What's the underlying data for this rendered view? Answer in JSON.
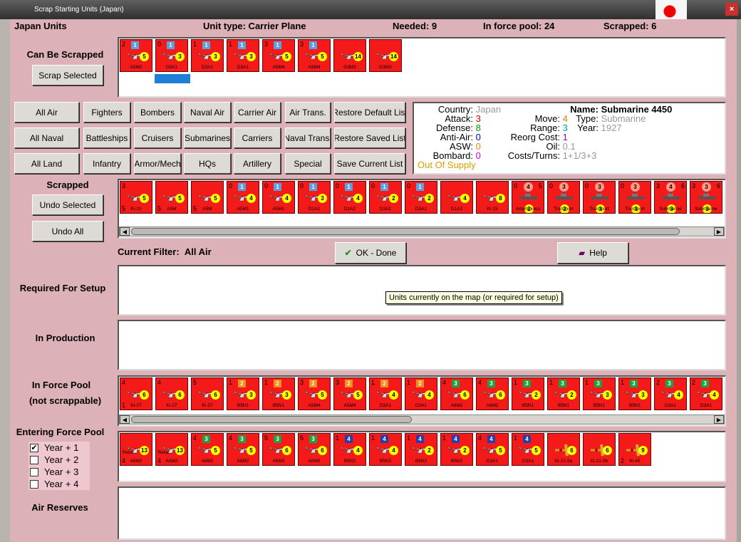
{
  "window": {
    "title": "Scrap Starting Units (Japan)"
  },
  "header": {
    "nation": "Japan Units",
    "unit_type": "Unit type: Carrier Plane",
    "needed": "Needed:  9",
    "force_pool": "In force pool:  24",
    "scrapped": "Scrapped:  6"
  },
  "sections": {
    "can_be_scrapped": "Can Be Scrapped",
    "scrapped": "Scrapped",
    "required": "Required For Setup",
    "in_production": "In Production",
    "in_force_pool": "In Force Pool",
    "not_scrappable": "(not scrappable)",
    "entering": "Entering Force Pool",
    "air_reserves": "Air Reserves"
  },
  "buttons": {
    "scrap_selected": "Scrap Selected",
    "undo_selected": "Undo Selected",
    "undo_all": "Undo All",
    "ok": "OK - Done",
    "help": "Help"
  },
  "filters": [
    [
      "All Air",
      "Fighters",
      "Bombers",
      "Naval Air",
      "Carrier Air",
      "Air Trans.",
      "Restore Default List"
    ],
    [
      "All Naval",
      "Battleships",
      "Cruisers",
      "Submarines",
      "Carriers",
      "Naval Trans.",
      "Restore Saved List"
    ],
    [
      "All Land",
      "Infantry",
      "Armor/Mech",
      "HQs",
      "Artillery",
      "Special",
      "Save Current List"
    ]
  ],
  "current_filter": {
    "label": "Current Filter:",
    "value": "All Air"
  },
  "tooltip": "Units currently on the map (or required for setup)",
  "info": {
    "country_k": "Country:",
    "country_v": "Japan",
    "attack_k": "Attack:",
    "attack_v": "3",
    "defense_k": "Defense:",
    "defense_v": "8",
    "antiair_k": "Anti-Air:",
    "antiair_v": "0",
    "asw_k": "ASW:",
    "asw_v": "0",
    "bombard_k": "Bombard:",
    "bombard_v": "0",
    "supply": "Out Of Supply",
    "move_k": "Move:",
    "move_v": "4",
    "range_k": "Range:",
    "range_v": "3",
    "reorg_k": "Reorg Cost:",
    "reorg_v": "1",
    "oil_k": "Oil:",
    "oil_v": "0.1",
    "costs_k": "Costs/Turns:",
    "costs_v": "1+1/3+3",
    "name_k": "Name:",
    "name_v": "Submarine 4450",
    "type_k": "Type:",
    "type_v": "Submarine",
    "year_k": "Year:",
    "year_v": "1927"
  },
  "years": [
    "Year + 1",
    "Year + 2",
    "Year + 3",
    "Year + 4"
  ],
  "counters": {
    "can_scrap": [
      {
        "tl": "2",
        "tr": "",
        "badge": "1",
        "bc": "#5aa0e0",
        "nm": "A5M2",
        "circ": "5",
        "bl": "",
        "br": "",
        "art": "plane"
      },
      {
        "tl": "0",
        "tr": "",
        "badge": "1",
        "bc": "#5aa0e0",
        "nm": "D3A1",
        "circ": "3",
        "bl": "",
        "br": "",
        "art": "plane"
      },
      {
        "tl": "1",
        "tr": "",
        "badge": "1",
        "bc": "#5aa0e0",
        "nm": "D3A1",
        "circ": "3",
        "bl": "",
        "br": "",
        "art": "plane"
      },
      {
        "tl": "1",
        "tr": "",
        "badge": "1",
        "bc": "#5aa0e0",
        "nm": "D3A1",
        "circ": "3",
        "bl": "",
        "br": "",
        "art": "plane"
      },
      {
        "tl": "3",
        "tr": "",
        "badge": "1",
        "bc": "#5aa0e0",
        "nm": "A5M4",
        "circ": "5",
        "bl": "",
        "br": "",
        "art": "plane"
      },
      {
        "tl": "3",
        "tr": "",
        "badge": "1",
        "bc": "#5aa0e0",
        "nm": "A5M4",
        "circ": "5",
        "bl": "",
        "br": "",
        "art": "plane"
      },
      {
        "tl": "",
        "tr": "",
        "badge": "",
        "bc": "",
        "nm": "G3M2",
        "circ": "14",
        "bl": "",
        "br": "",
        "art": "plane"
      },
      {
        "tl": "",
        "tr": "",
        "badge": "",
        "bc": "",
        "nm": "G3M2",
        "circ": "14",
        "bl": "",
        "br": "",
        "art": "plane"
      }
    ],
    "scrapped": [
      {
        "tl": "3",
        "tr": "",
        "badge": "",
        "bc": "",
        "nm": "Ki-10",
        "circ": "5",
        "bl": "5",
        "br": "",
        "art": "plane"
      },
      {
        "tl": "",
        "tr": "",
        "badge": "",
        "bc": "",
        "nm": "A5M",
        "circ": "5",
        "bl": "5",
        "br": "",
        "art": "plane"
      },
      {
        "tl": "",
        "tr": "",
        "badge": "",
        "bc": "",
        "nm": "A5M",
        "circ": "5",
        "bl": "5",
        "br": "",
        "art": "plane"
      },
      {
        "tl": "0",
        "tr": "",
        "badge": "1",
        "bc": "#5aa0e0",
        "nm": "A5M1",
        "circ": "4",
        "bl": "",
        "br": "",
        "art": "plane"
      },
      {
        "tl": "0",
        "tr": "",
        "badge": "1",
        "bc": "#5aa0e0",
        "nm": "A5M1",
        "circ": "4",
        "bl": "",
        "br": "",
        "art": "plane"
      },
      {
        "tl": "0",
        "tr": "",
        "badge": "1",
        "bc": "#5aa0e0",
        "nm": "D1A2",
        "circ": "3",
        "bl": "",
        "br": "",
        "art": "plane"
      },
      {
        "tl": "0",
        "tr": "",
        "badge": "1",
        "bc": "#5aa0e0",
        "nm": "D1A2",
        "circ": "4",
        "bl": "",
        "br": "",
        "art": "plane"
      },
      {
        "tl": "0",
        "tr": "",
        "badge": "1",
        "bc": "#5aa0e0",
        "nm": "D3A1",
        "circ": "2",
        "bl": "",
        "br": "",
        "art": "plane"
      },
      {
        "tl": "0",
        "tr": "",
        "badge": "1",
        "bc": "#5aa0e0",
        "nm": "D3A1",
        "circ": "2",
        "bl": "",
        "br": "",
        "art": "plane"
      },
      {
        "tl": "",
        "tr": "",
        "badge": "",
        "bc": "",
        "nm": "D1A2",
        "circ": "4",
        "bl": "",
        "br": "",
        "art": "plane"
      },
      {
        "tl": "",
        "tr": "",
        "badge": "",
        "bc": "",
        "nm": "Ki-15",
        "circ": "8",
        "bl": "",
        "br": "",
        "art": "plane"
      },
      {
        "tl": "0",
        "tr": "5",
        "badge": "",
        "bc": "",
        "nm": "Amphibious",
        "circ": "2",
        "bl": "",
        "br": "",
        "art": "ship",
        "ctop": "4"
      },
      {
        "tl": "0",
        "tr": "",
        "badge": "",
        "bc": "",
        "nm": "Transport",
        "circ": "2",
        "bl": "",
        "br": "",
        "art": "ship",
        "ctop": "3"
      },
      {
        "tl": "0",
        "tr": "",
        "badge": "",
        "bc": "",
        "nm": "Transport",
        "circ": "3",
        "bl": "",
        "br": "",
        "art": "ship",
        "ctop": "3"
      },
      {
        "tl": "0",
        "tr": "",
        "badge": "",
        "bc": "",
        "nm": "Transport",
        "circ": "3",
        "bl": "",
        "br": "",
        "art": "ship",
        "ctop": "3"
      },
      {
        "tl": "3",
        "tr": "6",
        "badge": "",
        "bc": "",
        "nm": "Submarine",
        "circ": "3",
        "bl": "",
        "br": "",
        "art": "ship",
        "ctop": "4"
      },
      {
        "tl": "3",
        "tr": "6",
        "badge": "",
        "bc": "",
        "nm": "Submarine",
        "circ": "3",
        "bl": "",
        "br": "",
        "art": "ship",
        "ctop": "3"
      }
    ],
    "force_pool": [
      {
        "tl": "4",
        "tr": "",
        "badge": "",
        "bc": "",
        "nm": "Ki-27",
        "circ": "6",
        "bl": "1",
        "br": "",
        "art": "plane"
      },
      {
        "tl": "4",
        "tr": "",
        "badge": "",
        "bc": "",
        "nm": "Ki-27",
        "circ": "6",
        "bl": "",
        "br": "",
        "art": "plane"
      },
      {
        "tl": "5",
        "tr": "",
        "badge": "",
        "bc": "",
        "nm": "Ki-27",
        "circ": "6",
        "bl": "",
        "br": "",
        "art": "plane"
      },
      {
        "tl": "1",
        "tr": "",
        "badge": "2",
        "bc": "#f09020",
        "nm": "B5N1",
        "circ": "3",
        "bl": "",
        "br": "",
        "art": "plane"
      },
      {
        "tl": "1",
        "tr": "",
        "badge": "2",
        "bc": "#f09020",
        "nm": "B5N1",
        "circ": "3",
        "bl": "",
        "br": "",
        "art": "plane"
      },
      {
        "tl": "3",
        "tr": "",
        "badge": "2",
        "bc": "#f09020",
        "nm": "A5M4",
        "circ": "5",
        "bl": "",
        "br": "",
        "art": "plane"
      },
      {
        "tl": "3",
        "tr": "",
        "badge": "2",
        "bc": "#f09020",
        "nm": "A5M4",
        "circ": "5",
        "bl": "",
        "br": "",
        "art": "plane"
      },
      {
        "tl": "1",
        "tr": "",
        "badge": "2",
        "bc": "#f09020",
        "nm": "D3A1",
        "circ": "4",
        "bl": "",
        "br": "",
        "art": "plane"
      },
      {
        "tl": "1",
        "tr": "",
        "badge": "2",
        "bc": "#f09020",
        "nm": "D3A1",
        "circ": "4",
        "bl": "",
        "br": "",
        "art": "plane"
      },
      {
        "tl": "4",
        "tr": "",
        "badge": "3",
        "bc": "#20a040",
        "nm": "A6M2",
        "circ": "6",
        "bl": "",
        "br": "",
        "art": "plane"
      },
      {
        "tl": "4",
        "tr": "",
        "badge": "3",
        "bc": "#20a040",
        "nm": "A6M2",
        "circ": "6",
        "bl": "",
        "br": "",
        "art": "plane"
      },
      {
        "tl": "1",
        "tr": "",
        "badge": "3",
        "bc": "#20a040",
        "nm": "B5N1",
        "circ": "2",
        "bl": "",
        "br": "",
        "art": "plane"
      },
      {
        "tl": "1",
        "tr": "",
        "badge": "3",
        "bc": "#20a040",
        "nm": "B5N1",
        "circ": "2",
        "bl": "",
        "br": "",
        "art": "plane"
      },
      {
        "tl": "1",
        "tr": "",
        "badge": "3",
        "bc": "#20a040",
        "nm": "B5N1",
        "circ": "3",
        "bl": "",
        "br": "",
        "art": "plane"
      },
      {
        "tl": "1",
        "tr": "",
        "badge": "3",
        "bc": "#20a040",
        "nm": "B5N1",
        "circ": "3",
        "bl": "",
        "br": "",
        "art": "plane"
      },
      {
        "tl": "2",
        "tr": "",
        "badge": "3",
        "bc": "#20a040",
        "nm": "D3A1",
        "circ": "4",
        "bl": "",
        "br": "",
        "art": "plane"
      },
      {
        "tl": "2",
        "tr": "",
        "badge": "3",
        "bc": "#20a040",
        "nm": "D3A1",
        "circ": "4",
        "bl": "",
        "br": "",
        "art": "plane"
      }
    ],
    "entering": [
      {
        "tl": "",
        "tr": "",
        "badge": "",
        "bc": "",
        "nm": "A6M2",
        "circ": "13",
        "bl": "4",
        "br": "",
        "art": "plane",
        "sub": "Reisen"
      },
      {
        "tl": "",
        "tr": "",
        "badge": "",
        "bc": "",
        "nm": "A6M2",
        "circ": "13",
        "bl": "4",
        "br": "",
        "art": "plane",
        "sub": "Reisen"
      },
      {
        "tl": "4",
        "tr": "",
        "badge": "3",
        "bc": "#20a040",
        "nm": "A6M2",
        "circ": "5",
        "bl": "",
        "br": "",
        "art": "plane"
      },
      {
        "tl": "4",
        "tr": "",
        "badge": "3",
        "bc": "#20a040",
        "nm": "A6M2",
        "circ": "5",
        "bl": "",
        "br": "",
        "art": "plane"
      },
      {
        "tl": "5",
        "tr": "",
        "badge": "3",
        "bc": "#20a040",
        "nm": "A6M3",
        "circ": "6",
        "bl": "",
        "br": "",
        "art": "plane"
      },
      {
        "tl": "5",
        "tr": "",
        "badge": "3",
        "bc": "#20a040",
        "nm": "A6M3",
        "circ": "6",
        "bl": "",
        "br": "",
        "art": "plane"
      },
      {
        "tl": "1",
        "tr": "",
        "badge": "4",
        "bc": "#2040b0",
        "nm": "B5N2",
        "circ": "4",
        "bl": "",
        "br": "",
        "art": "plane"
      },
      {
        "tl": "1",
        "tr": "",
        "badge": "4",
        "bc": "#2040b0",
        "nm": "B5N2",
        "circ": "4",
        "bl": "",
        "br": "",
        "art": "plane"
      },
      {
        "tl": "1",
        "tr": "",
        "badge": "4",
        "bc": "#2040b0",
        "nm": "B5N2",
        "circ": "2",
        "bl": "",
        "br": "",
        "art": "plane"
      },
      {
        "tl": "1",
        "tr": "",
        "badge": "4",
        "bc": "#2040b0",
        "nm": "B5N2",
        "circ": "2",
        "bl": "",
        "br": "",
        "art": "plane"
      },
      {
        "tl": "4",
        "tr": "",
        "badge": "4",
        "bc": "#2040b0",
        "nm": "D3A1",
        "circ": "5",
        "bl": "",
        "br": "",
        "art": "plane"
      },
      {
        "tl": "1",
        "tr": "",
        "badge": "4",
        "bc": "#2040b0",
        "nm": "D3A1",
        "circ": "5",
        "bl": "",
        "br": "",
        "art": "plane"
      },
      {
        "tl": "",
        "tr": "",
        "badge": "",
        "bc": "",
        "nm": "Ki-21-IIa",
        "circ": "6",
        "bl": "",
        "br": "",
        "art": "bomber"
      },
      {
        "tl": "",
        "tr": "",
        "badge": "",
        "bc": "",
        "nm": "Ki-21-IIb",
        "circ": "6",
        "bl": "",
        "br": "",
        "art": "bomber"
      },
      {
        "tl": "",
        "tr": "",
        "badge": "",
        "bc": "",
        "nm": "Ki-45",
        "circ": "9",
        "bl": "2",
        "br": "",
        "art": "bomber"
      }
    ]
  }
}
